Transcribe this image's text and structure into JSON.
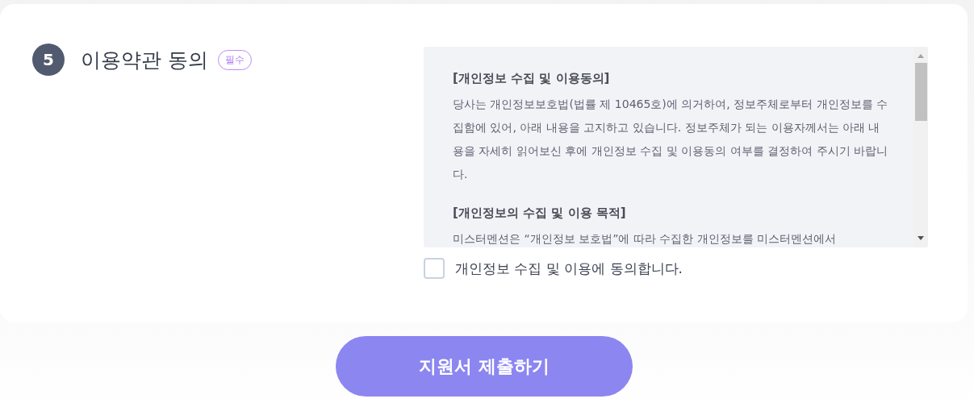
{
  "section": {
    "number": "5",
    "title": "이용약관 동의",
    "badge": "필수"
  },
  "terms": [
    {
      "heading": "[개인정보 수집 및 이용동의]",
      "body": "당사는 개인정보보호법(법률 제 10465호)에 의거하여, 정보주체로부터 개인정보를 수집함에 있어, 아래 내용을 고지하고 있습니다. 정보주체가 되는 이용자께서는 아래 내용을 자세히 읽어보신 후에 개인정보 수집 및 이용동의 여부를 결정하여 주시기 바랍니다."
    },
    {
      "heading": "[개인정보의 수집 및 이용 목적]",
      "body": "미스터멘션은 “개인정보 보호법”에 따라 수집한 개인정보를 미스터멘션에서"
    }
  ],
  "agree": {
    "label": "개인정보 수집 및 이용에 동의합니다.",
    "checked": false
  },
  "submit": {
    "label": "지원서 제출하기"
  }
}
